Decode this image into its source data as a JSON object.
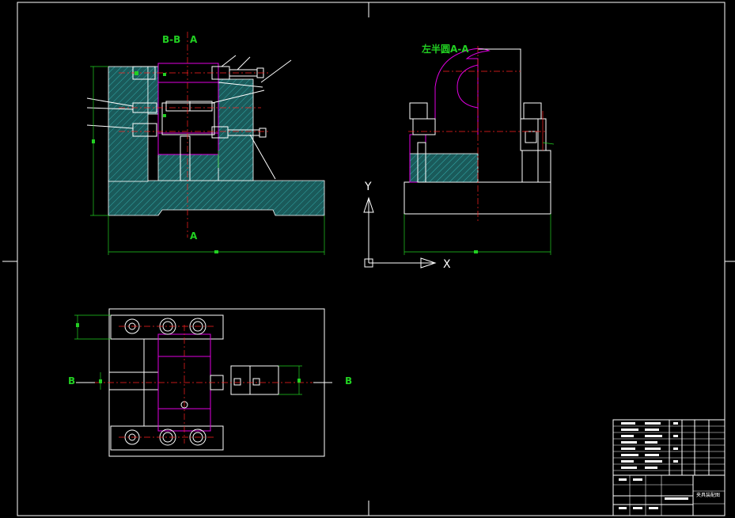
{
  "drawing": {
    "section_label_main": "B-B",
    "section_letter_top": "A",
    "section_letter_bottom": "A",
    "side_view_label": "左半圆A-A",
    "axis_y": "Y",
    "axis_x": "X",
    "bottom_section_left": "B",
    "bottom_section_right": "B",
    "title_block_name": "夹具装配图"
  },
  "colors": {
    "outline": "#ffffff",
    "part_magenta": "#e000e0",
    "centerline": "#ff2020",
    "dimension": "#22d022",
    "background": "#000000"
  }
}
